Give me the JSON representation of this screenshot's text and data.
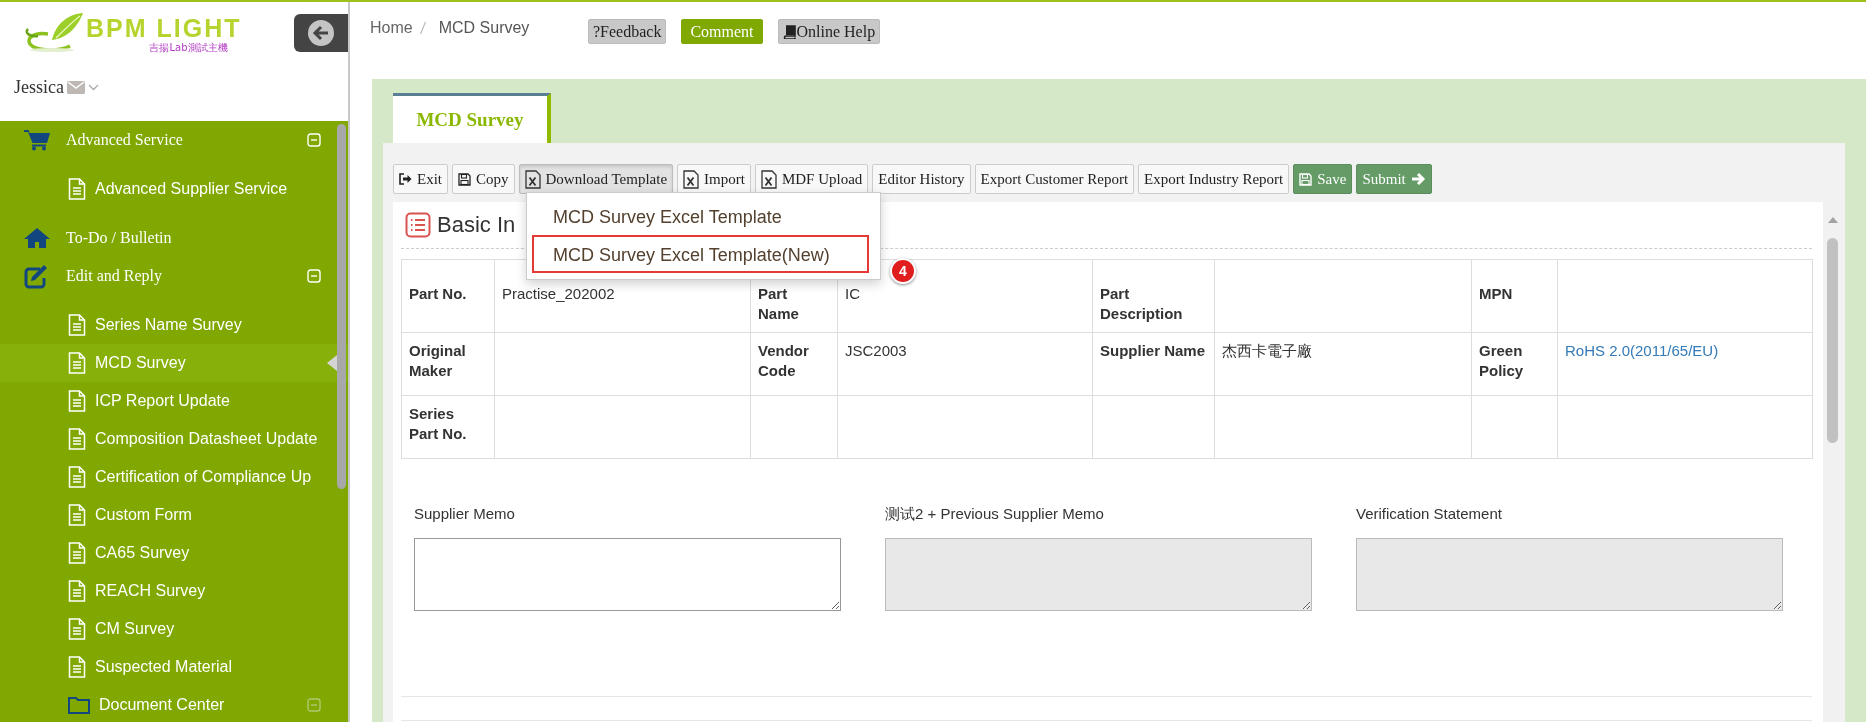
{
  "logo": {
    "name": "BPM LIGHT",
    "subtitle": "吉揚Lab測試主機"
  },
  "user": {
    "name": "Jessica"
  },
  "sidebar": {
    "items": [
      {
        "kind": "group",
        "label": "Advanced Service",
        "expanded": true,
        "children": [
          {
            "kind": "page",
            "label": "Advanced Supplier Service",
            "selected": false
          }
        ]
      },
      {
        "kind": "link",
        "label": "To-Do / Bulletin"
      },
      {
        "kind": "group",
        "label": "Edit and Reply",
        "expanded": true,
        "children": [
          {
            "kind": "page",
            "label": "Series Name Survey",
            "selected": false
          },
          {
            "kind": "page",
            "label": "MCD Survey",
            "selected": true
          },
          {
            "kind": "page",
            "label": "ICP Report Update",
            "selected": false
          },
          {
            "kind": "page",
            "label": "Composition Datasheet Update",
            "selected": false
          },
          {
            "kind": "page",
            "label": "Certification of Compliance Up",
            "selected": false
          },
          {
            "kind": "page",
            "label": "Custom Form",
            "selected": false
          },
          {
            "kind": "page",
            "label": "CA65 Survey",
            "selected": false
          },
          {
            "kind": "page",
            "label": "REACH Survey",
            "selected": false
          },
          {
            "kind": "page",
            "label": "CM Survey",
            "selected": false
          },
          {
            "kind": "page",
            "label": "Suspected Material",
            "selected": false
          },
          {
            "kind": "folder",
            "label": "Document Center",
            "selected": false,
            "expanded": true
          }
        ]
      }
    ]
  },
  "breadcrumb": [
    "Home",
    "MCD Survey"
  ],
  "header_buttons": [
    {
      "label": "?Feedback",
      "kind": "default"
    },
    {
      "label": "Comment",
      "kind": "primary"
    },
    {
      "label": "Online Help",
      "kind": "book"
    }
  ],
  "tabs": [
    {
      "label": "MCD Survey",
      "selected": true
    }
  ],
  "toolbar": [
    {
      "label": "Exit",
      "kind": "exit",
      "pressed": false
    },
    {
      "label": "Copy",
      "kind": "copy",
      "pressed": false
    },
    {
      "label": "Download Template",
      "kind": "excel",
      "pressed": true
    },
    {
      "label": "Import",
      "kind": "excel",
      "pressed": false
    },
    {
      "label": "MDF Upload",
      "kind": "excel",
      "pressed": false
    },
    {
      "label": "Editor History",
      "kind": "plain",
      "pressed": false
    },
    {
      "label": "Export Customer Report",
      "kind": "plain",
      "pressed": false
    },
    {
      "label": "Export Industry Report",
      "kind": "plain",
      "pressed": false
    },
    {
      "label": "Save",
      "kind": "save",
      "pressed": false
    },
    {
      "label": "Submit",
      "kind": "submit",
      "pressed": false
    }
  ],
  "download_menu": {
    "items": [
      {
        "label": "MCD Survey Excel Template",
        "annotated": false
      },
      {
        "label": "MCD Survey Excel Template(New)",
        "annotated": true
      }
    ],
    "callout": "4"
  },
  "section": {
    "title": "Basic In"
  },
  "details": {
    "rows": [
      [
        {
          "label": "Part No.",
          "value": "Practise_202002"
        },
        {
          "label": "Part Name",
          "value": "IC"
        },
        {
          "label": "Part Description"
        },
        {
          "label": "MPN"
        }
      ],
      [
        {
          "label": "Original Maker"
        },
        {
          "label": "Vendor Code",
          "value": "JSC2003"
        },
        {
          "label": "Supplier Name",
          "value": "杰西卡電子廠"
        },
        {
          "label": "Green Policy",
          "value": "RoHS 2.0(2011/65/EU)",
          "kind": "link"
        }
      ],
      [
        {
          "label": "Series Part No."
        }
      ]
    ]
  },
  "memos": [
    {
      "label": "Supplier Memo",
      "readonly": false
    },
    {
      "label": "测试2 + Previous Supplier Memo",
      "readonly": true
    },
    {
      "label": "Verification Statement",
      "readonly": true
    }
  ]
}
